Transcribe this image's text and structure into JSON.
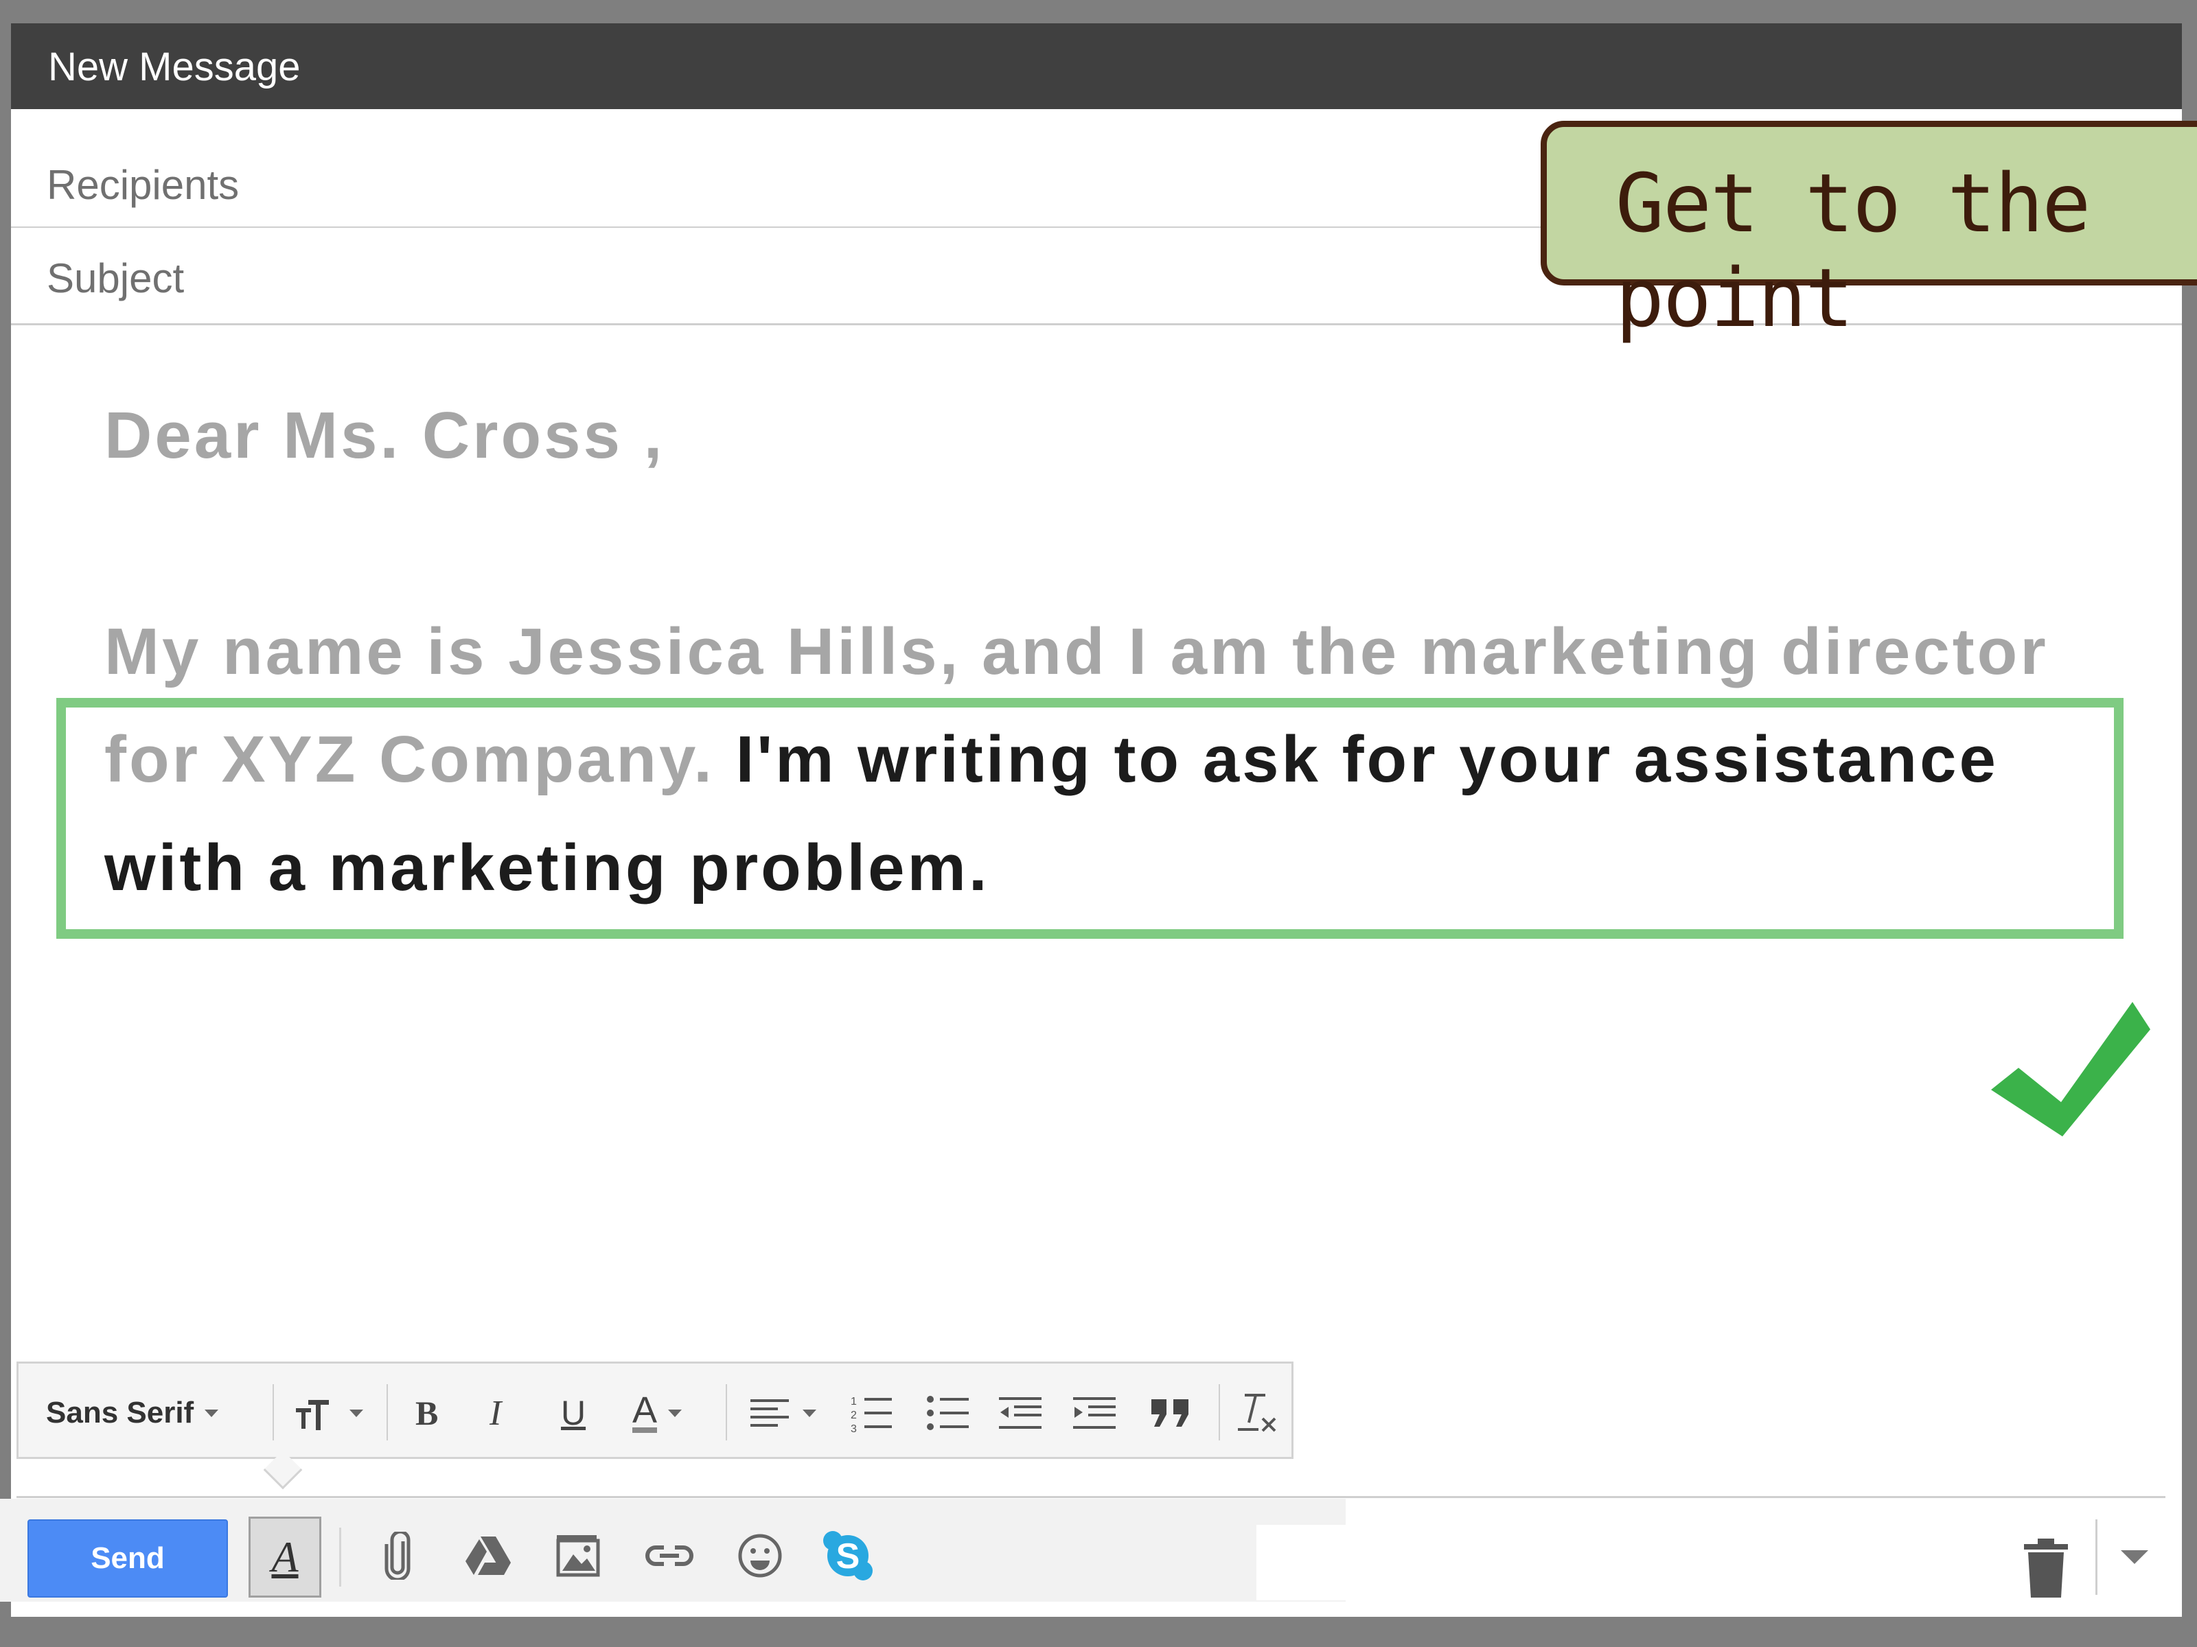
{
  "window": {
    "title": "New Message"
  },
  "fields": {
    "recipients_placeholder": "Recipients",
    "subject_placeholder": "Subject"
  },
  "body": {
    "greeting": "Dear Ms. Cross ,",
    "line1": "My name is Jessica Hills, and I am the marketing director",
    "line2_faded": "for XYZ Company.",
    "line2_highlight": "I'm writing to ask for your assistance",
    "line3_highlight": "with a marketing problem."
  },
  "callout": {
    "text": "Get to the point"
  },
  "format_toolbar": {
    "font": "Sans Serif",
    "icons": [
      "text-size-icon",
      "bold-icon",
      "italic-icon",
      "underline-icon",
      "text-color-icon",
      "align-icon",
      "numbered-list-icon",
      "bulleted-list-icon",
      "indent-less-icon",
      "indent-more-icon",
      "quote-icon",
      "remove-formatting-icon"
    ]
  },
  "bottom_toolbar": {
    "send_label": "Send",
    "icons": [
      "formatting-toggle-icon",
      "attach-icon",
      "drive-icon",
      "photo-icon",
      "link-icon",
      "emoji-icon",
      "skype-icon",
      "trash-icon",
      "more-options-icon"
    ]
  },
  "colors": {
    "titlebar": "#404040",
    "send": "#4c8bf5",
    "highlight_border": "#7fcb82",
    "callout_bg": "#c2d6a2",
    "callout_border": "#4a2411",
    "checkmark": "#3bb24a",
    "faded_text": "#a6a6a6"
  }
}
